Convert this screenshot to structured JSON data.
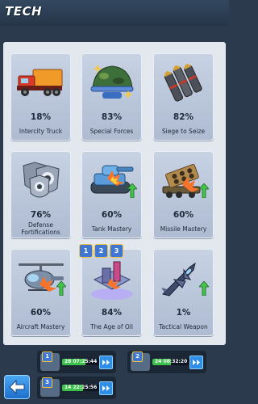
{
  "header": {
    "title": "TECH"
  },
  "tech_cards": [
    {
      "name": "Intercity Truck",
      "percent": "18%"
    },
    {
      "name": "Special Forces",
      "percent": "83%"
    },
    {
      "name": "Siege to Seize",
      "percent": "82%"
    },
    {
      "name": "Defense Fortifications",
      "percent": "76%"
    },
    {
      "name": "Tank Mastery",
      "percent": "60%"
    },
    {
      "name": "Missile Mastery",
      "percent": "60%"
    },
    {
      "name": "Aircraft Mastery",
      "percent": "60%"
    },
    {
      "name": "The Age of Oil",
      "percent": "84%"
    },
    {
      "name": "Tactical Weapon",
      "percent": "1%"
    }
  ],
  "age_of_oil_badges": [
    "1",
    "2",
    "3"
  ],
  "research_queue": [
    {
      "slot": "1",
      "timer": "28 07:25:44",
      "progress": 0.55
    },
    {
      "slot": "2",
      "timer": "24 08:32:20",
      "progress": 0.45
    },
    {
      "slot": "3",
      "timer": "14 22:25:56",
      "progress": 0.5
    }
  ],
  "colors": {
    "accent": "#2f8ee8",
    "progress": "#3bc24a",
    "upgrade_arrow": "#43c54c"
  }
}
